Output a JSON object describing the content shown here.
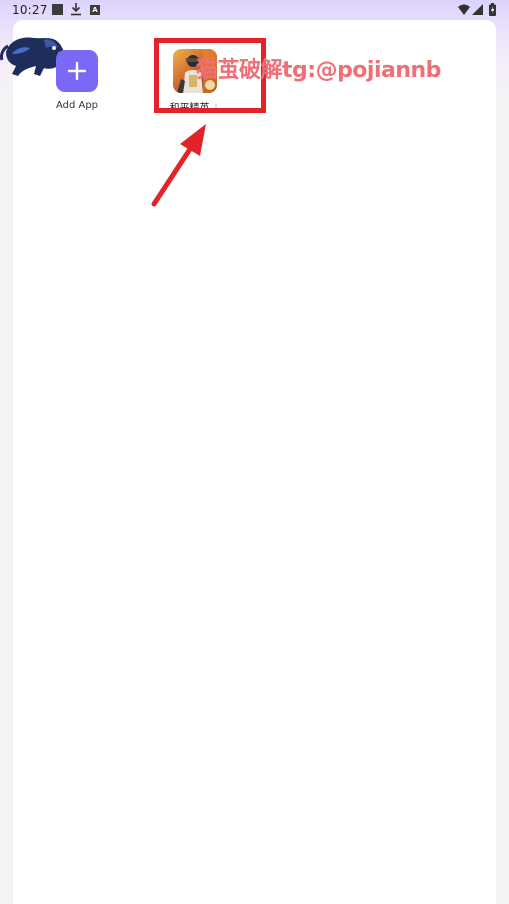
{
  "status_bar": {
    "time": "10:27",
    "icons": [
      "stop-square-icon",
      "download-icon",
      "a-badge-icon",
      "wifi-icon",
      "signal-icon",
      "battery-icon"
    ]
  },
  "apps": {
    "add_app": {
      "label": "Add App",
      "icon": "plus-icon",
      "color": "#7b68f4"
    },
    "game": {
      "label": "和平精英",
      "menu_glyph": "⋮",
      "icon": "game-app-icon"
    }
  },
  "overlay": {
    "watermark": "猫茧破解tg:@pojiannb",
    "highlight_color": "#e2232a",
    "watermark_color": "#ef6f76"
  }
}
